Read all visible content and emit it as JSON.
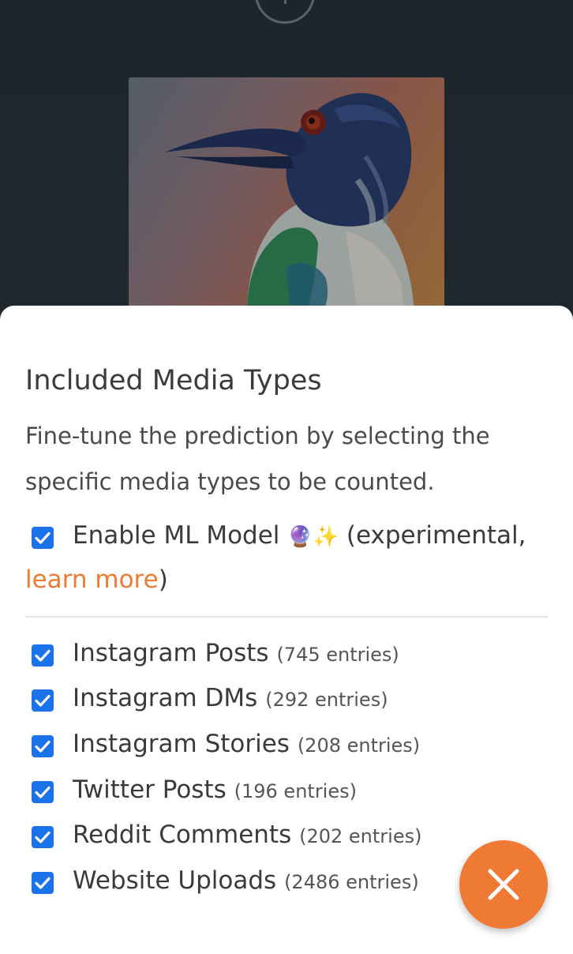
{
  "background": {
    "plus_icon": "plus-circle-icon",
    "photo": "bird-photo"
  },
  "sheet": {
    "title": "Included Media Types",
    "description": "Fine-tune the prediction by selecting the specific media types to be counted.",
    "ml_toggle": {
      "checked": true,
      "label": "Enable ML Model",
      "emoji": "🔮✨",
      "suffix": "(experimental,",
      "link_text": "learn more",
      "closing": ")"
    },
    "media_types": [
      {
        "label": "Instagram Posts",
        "count": "(745 entries)",
        "checked": true
      },
      {
        "label": "Instagram DMs",
        "count": "(292 entries)",
        "checked": true
      },
      {
        "label": "Instagram Stories",
        "count": "(208 entries)",
        "checked": true
      },
      {
        "label": "Twitter Posts",
        "count": "(196 entries)",
        "checked": true
      },
      {
        "label": "Reddit Comments",
        "count": "(202 entries)",
        "checked": true
      },
      {
        "label": "Website Uploads",
        "count": "(2486 entries)",
        "checked": true
      }
    ],
    "close_icon": "close-icon"
  },
  "colors": {
    "accent": "#ee7a33",
    "checkbox": "#1a73e8",
    "backdrop": "#1f262d"
  }
}
